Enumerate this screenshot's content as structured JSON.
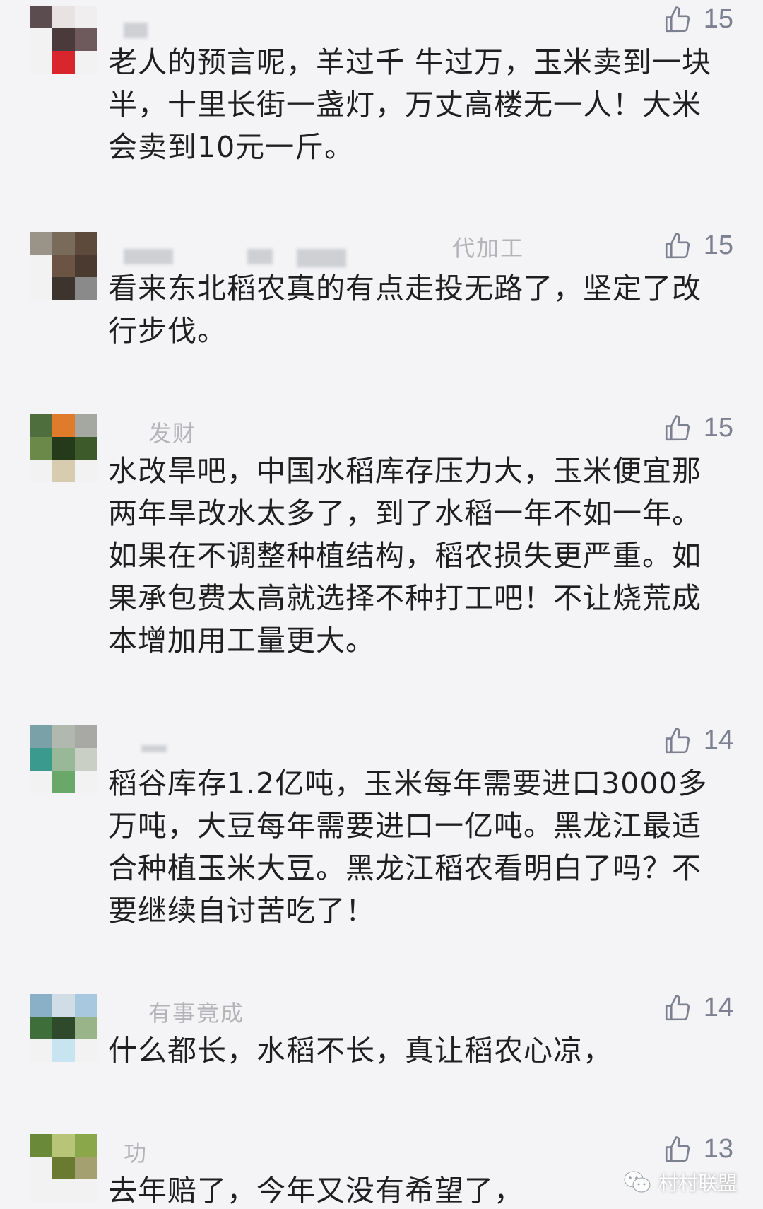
{
  "comments": [
    {
      "username": "",
      "likes": "15",
      "text": "老人的预言呢，羊过千 牛过万，玉米卖到一块半，十里长街一盏灯，万丈高楼无一人！大米会卖到10元一斤。"
    },
    {
      "username": "代加工",
      "likes": "15",
      "text": "看来东北稻农真的有点走投无路了，坚定了改行步伐。"
    },
    {
      "username": "发财",
      "likes": "15",
      "text": "水改旱吧，中国水稻库存压力大，玉米便宜那两年旱改水太多了，到了水稻一年不如一年。如果在不调整种植结构，稻农损失更严重。如果承包费太高就选择不种打工吧！不让烧荒成本增加用工量更大。"
    },
    {
      "username": "",
      "likes": "14",
      "text": "稻谷库存1.2亿吨，玉米每年需要进口3000多万吨，大豆每年需要进口一亿吨。黑龙江最适合种植玉米大豆。黑龙江稻农看明白了吗？不要继续自讨苦吃了！"
    },
    {
      "username": "有事竟成",
      "likes": "14",
      "text": "什么都长，水稻不长，真让稻农心凉，"
    },
    {
      "username": "功",
      "likes": "13",
      "text": "去年赔了，今年又没有希望了，"
    }
  ],
  "watermark": {
    "text": "村村联盟"
  },
  "colors": {
    "background": "#f4f4f6",
    "text": "#1f1f1f",
    "muted": "#7c8090"
  }
}
